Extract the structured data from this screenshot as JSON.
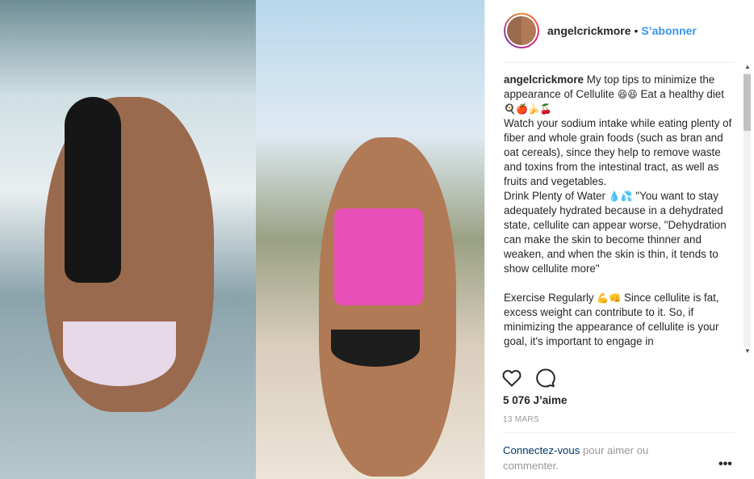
{
  "header": {
    "username": "angelcrickmore",
    "separator": "•",
    "follow_label": "S’abonner"
  },
  "caption": {
    "username": "angelcrickmore",
    "line1": "My top tips to minimize the appearance of Cellulite",
    "emoji1": "😆😆",
    "line2": "Eat a healthy diet",
    "emoji2": "🍳🍎🍌🍒",
    "para2": "Watch your sodium intake while eating plenty of fiber and whole grain foods (such as bran and oat cereals), since they help to remove waste and toxins from the intestinal tract, as well as fruits and vegetables.",
    "line3": "Drink Plenty of Water",
    "emoji3": "💧💦",
    "para3": "\"You want to stay adequately hydrated because in a dehydrated state, cellulite can appear worse, \"Dehydration can make the skin to become thinner and weaken, and when the skin is thin, it tends to show cellulite more\"",
    "line4": "Exercise Regularly",
    "emoji4": "💪👊",
    "para4": "Since cellulite is fat, excess weight can contribute to it. So, if minimizing the appearance of cellulite is your goal, it's important to engage in"
  },
  "stats": {
    "likes": "5 076 J’aime",
    "date": "13 MARS"
  },
  "login_prompt": {
    "link": "Connectez-vous",
    "text": " pour aimer ou commenter."
  },
  "icons": {
    "like": "heart-icon",
    "comment": "comment-icon",
    "more": "more-options-icon"
  },
  "colors": {
    "follow": "#3897f0",
    "link": "#003569",
    "muted": "#999999"
  }
}
